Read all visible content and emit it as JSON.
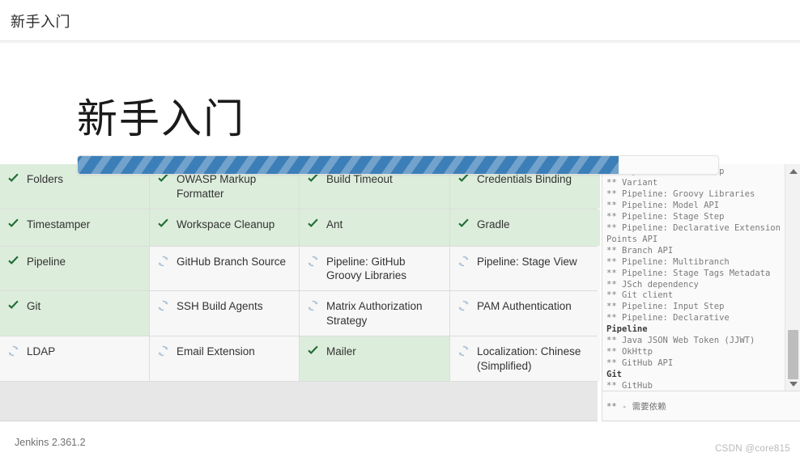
{
  "topbar": {
    "title": "新手入门"
  },
  "page": {
    "heading": "新手入门"
  },
  "progress": {
    "percent": 84.5,
    "fill_color": "#3c7fb8",
    "track_color": "#fbfbfb"
  },
  "colors": {
    "installed_cell_bg": "#dceddb",
    "pending_cell_bg": "#f7f7f7",
    "check_icon": "#1f6b33",
    "spinner_icon": "#a8bfd4",
    "accent": "#3c7fb8"
  },
  "plugins": {
    "status_legend": {
      "done": "installed",
      "pending": "installing"
    },
    "items": [
      {
        "name": "Folders",
        "status": "done"
      },
      {
        "name": "OWASP Markup Formatter",
        "status": "done"
      },
      {
        "name": "Build Timeout",
        "status": "done"
      },
      {
        "name": "Credentials Binding",
        "status": "done"
      },
      {
        "name": "Timestamper",
        "status": "done"
      },
      {
        "name": "Workspace Cleanup",
        "status": "done"
      },
      {
        "name": "Ant",
        "status": "done"
      },
      {
        "name": "Gradle",
        "status": "done"
      },
      {
        "name": "Pipeline",
        "status": "done"
      },
      {
        "name": "GitHub Branch Source",
        "status": "pending"
      },
      {
        "name": "Pipeline: GitHub Groovy Libraries",
        "status": "pending"
      },
      {
        "name": "Pipeline: Stage View",
        "status": "pending"
      },
      {
        "name": "Git",
        "status": "done"
      },
      {
        "name": "SSH Build Agents",
        "status": "pending"
      },
      {
        "name": "Matrix Authorization Strategy",
        "status": "pending"
      },
      {
        "name": "PAM Authentication",
        "status": "pending"
      },
      {
        "name": "LDAP",
        "status": "pending"
      },
      {
        "name": "Email Extension",
        "status": "pending"
      },
      {
        "name": "Mailer",
        "status": "done"
      },
      {
        "name": "Localization: Chinese (Simplified)",
        "status": "pending"
      }
    ]
  },
  "log": {
    "lines": [
      {
        "text": "** Pipeline: Build Step",
        "dep": false
      },
      {
        "text": "** Variant",
        "dep": false
      },
      {
        "text": "** Pipeline: Groovy Libraries",
        "dep": false
      },
      {
        "text": "** Pipeline: Model API",
        "dep": false
      },
      {
        "text": "** Pipeline: Stage Step",
        "dep": false
      },
      {
        "text": "** Pipeline: Declarative Extension Points API",
        "dep": false
      },
      {
        "text": "** Branch API",
        "dep": false
      },
      {
        "text": "** Pipeline: Multibranch",
        "dep": false
      },
      {
        "text": "** Pipeline: Stage Tags Metadata",
        "dep": false
      },
      {
        "text": "** JSch dependency",
        "dep": false
      },
      {
        "text": "** Git client",
        "dep": false
      },
      {
        "text": "** Pipeline: Input Step",
        "dep": false
      },
      {
        "text": "** Pipeline: Declarative",
        "dep": false
      },
      {
        "text": "Pipeline",
        "dep": true
      },
      {
        "text": "** Java JSON Web Token (JJWT)",
        "dep": false
      },
      {
        "text": "** OkHttp",
        "dep": false
      },
      {
        "text": "** GitHub API",
        "dep": false
      },
      {
        "text": "Git",
        "dep": true
      },
      {
        "text": "** GitHub",
        "dep": false
      }
    ],
    "footer_note": "** - 需要依赖",
    "scrollbar": {
      "up_arrow": "scroll-up",
      "down_arrow": "scroll-down",
      "thumb_position": "near-bottom"
    }
  },
  "footer": {
    "version": "Jenkins 2.361.2",
    "watermark": "CSDN @core815"
  }
}
